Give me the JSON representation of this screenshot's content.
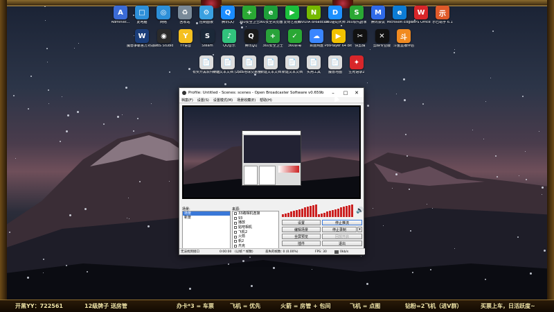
{
  "desktop": {
    "row1": [
      {
        "label": "Administ...",
        "color": "#3b6bd6",
        "glyph": "A",
        "icon": "user-folder-icon"
      },
      {
        "label": "此电脑",
        "color": "#2d8fd8",
        "glyph": "□",
        "icon": "computer-icon"
      },
      {
        "label": "网络",
        "color": "#2d8fd8",
        "glyph": "◎",
        "icon": "network-icon"
      },
      {
        "label": "回收站",
        "color": "#7a8a99",
        "glyph": "♻",
        "icon": "recycle-bin-icon"
      },
      {
        "label": "控制面板",
        "color": "#3aa0e0",
        "glyph": "⚙",
        "icon": "control-panel-icon"
      },
      {
        "label": "腾讯QQ",
        "color": "#1a8cff",
        "glyph": "Q",
        "icon": "qq-icon"
      },
      {
        "label": "360安全卫士",
        "color": "#2aa834",
        "glyph": "+",
        "icon": "shield-icon"
      },
      {
        "label": "360安全浏览器",
        "color": "#1ea03a",
        "glyph": "e",
        "icon": "browser-icon"
      },
      {
        "label": "爱奇艺视频",
        "color": "#1cbf3c",
        "glyph": "▶",
        "icon": "video-icon"
      },
      {
        "label": "NVIDIA Broadcast",
        "color": "#76b900",
        "glyph": "N",
        "icon": "nvidia-icon"
      },
      {
        "label": "360驱动大师",
        "color": "#1e90ff",
        "glyph": "D",
        "icon": "driver-icon"
      },
      {
        "label": "360软件管家",
        "color": "#2aa834",
        "glyph": "S",
        "icon": "software-manager-icon"
      },
      {
        "label": "腾讯会议",
        "color": "#2f6ae8",
        "glyph": "M",
        "icon": "meeting-icon"
      },
      {
        "label": "Microsoft Edge",
        "color": "#0c7cd5",
        "glyph": "e",
        "icon": "edge-icon"
      },
      {
        "label": "WPS Office",
        "color": "#d8262a",
        "glyph": "W",
        "icon": "wps-icon"
      },
      {
        "label": "示巴助手 6.1",
        "color": "#e05a2a",
        "glyph": "示",
        "icon": "assistant-icon"
      }
    ],
    "row2": [
      {
        "label": "魔兽争霸官方对战平台",
        "color": "#1b3e7a",
        "glyph": "W",
        "icon": "warcraft-icon"
      },
      {
        "label": "OBS Studio",
        "color": "#2b2b2b",
        "glyph": "◉",
        "icon": "obs-icon"
      },
      {
        "label": "YY语音",
        "color": "#f5c020",
        "glyph": "Y",
        "icon": "yy-icon"
      },
      {
        "label": "Steam",
        "color": "#1b2838",
        "glyph": "S",
        "icon": "steam-icon"
      },
      {
        "label": "QQ音乐",
        "color": "#31c27c",
        "glyph": "♪",
        "icon": "music-icon"
      },
      {
        "label": "腾讯QQ",
        "color": "#1a1a1a",
        "glyph": "Q",
        "icon": "qq-penguin-icon"
      },
      {
        "label": "360安全卫士",
        "color": "#29a33a",
        "glyph": "+",
        "icon": "security-icon"
      },
      {
        "label": "360杀毒",
        "color": "#2aa834",
        "glyph": "✓",
        "icon": "antivirus-icon"
      },
      {
        "label": "百度网盘",
        "color": "#3a86ff",
        "glyph": "☁",
        "icon": "cloud-drive-icon"
      },
      {
        "label": "PotPlayer 64 bit",
        "color": "#f2c200",
        "glyph": "▶",
        "icon": "potplayer-icon"
      },
      {
        "label": "快剪辑",
        "color": "#111",
        "glyph": "✂",
        "icon": "video-editor-icon"
      },
      {
        "label": "剪映专业版",
        "color": "#111",
        "glyph": "✕",
        "icon": "capcut-icon"
      },
      {
        "label": "斗鱼直播伴侣",
        "color": "#f08a20",
        "glyph": "斗",
        "icon": "douyu-icon"
      }
    ],
    "row3": [
      {
        "label": "有奖开黑软件平台",
        "color": "#ddd",
        "glyph": "📄",
        "icon": "file-icon"
      },
      {
        "label": "新建文本文档 (2).txt",
        "color": "#ddd",
        "glyph": "📄",
        "icon": "text-file-icon"
      },
      {
        "label": "5c5地球交易量",
        "color": "#ddd",
        "glyph": "📄",
        "icon": "document-icon"
      },
      {
        "label": "新建文本文档",
        "color": "#ddd",
        "glyph": "📄",
        "icon": "text-file-icon"
      },
      {
        "label": "新建文本文档",
        "color": "#ddd",
        "glyph": "📄",
        "icon": "text-file-icon"
      },
      {
        "label": "实用工具",
        "color": "#ddd",
        "glyph": "📄",
        "icon": "tools-file-icon"
      },
      {
        "label": "魔兽地图",
        "color": "#ddd",
        "glyph": "📄",
        "icon": "map-file-icon"
      },
      {
        "label": "生死语录2",
        "color": "#d8262a",
        "glyph": "✦",
        "icon": "app-icon"
      }
    ]
  },
  "obs": {
    "title": "Profile: Untitled - Scenes: scenes - Open Broadcaster Software v0.659b",
    "menu": [
      "档案(F)",
      "设置(S)",
      "设置模式(M)",
      "场景收藏(E)",
      "帮助(H)"
    ],
    "scenes_label": "场景:",
    "sources_label": "来源:",
    "scenes": [
      "场景",
      "新景"
    ],
    "sources": [
      "33路相机连接",
      "93",
      "播放",
      "贴吧相机",
      "飞机2",
      "火箭",
      "帆2",
      "杰克"
    ],
    "buttons": {
      "settings": "设置",
      "stop_stream": "停止推流",
      "edit_scene": "编辑场景",
      "stop_record": "停止录制",
      "fullscreen_preview": "全屏预览",
      "replay": "回放开启",
      "plugins": "插件",
      "exit": "退出"
    },
    "status": {
      "left": "无法找到接口",
      "time": "0:00:00",
      "dropped": "(以帧 * 帧数)",
      "conn": "丢失的帧数: 0 (0.00%)",
      "fps": "FPS: 30",
      "bitrate": "0kb/s"
    }
  },
  "ticker": [
    "开黑YY：722561",
    "12级牌子 送房管",
    "办卡*3 = 车票",
    "飞机 = 优先",
    "火箭 = 房管 + 包间",
    "飞机 = 点图",
    "钻粉=2飞机（进V群）",
    "买票上车，日活跃度~"
  ]
}
